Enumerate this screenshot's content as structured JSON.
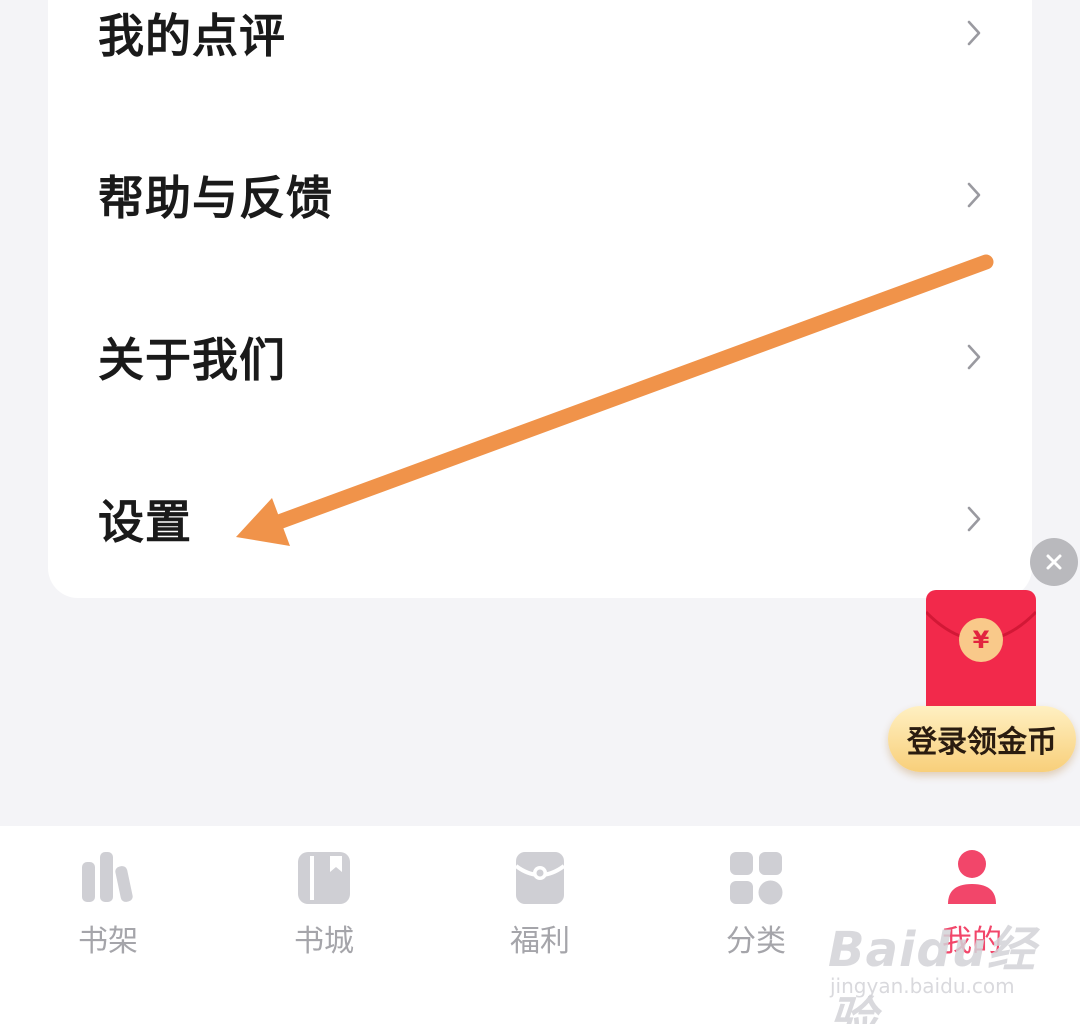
{
  "menu": {
    "items": [
      {
        "label": "我的点评"
      },
      {
        "label": "帮助与反馈"
      },
      {
        "label": "关于我们"
      },
      {
        "label": "设置"
      }
    ]
  },
  "promo": {
    "coin_symbol": "¥",
    "button_label": "登录领金币"
  },
  "tabbar": {
    "tabs": [
      {
        "label": "书架",
        "icon": "bookshelf-icon",
        "active": false
      },
      {
        "label": "书城",
        "icon": "book-icon",
        "active": false
      },
      {
        "label": "福利",
        "icon": "gift-icon",
        "active": false
      },
      {
        "label": "分类",
        "icon": "category-icon",
        "active": false
      },
      {
        "label": "我的",
        "icon": "profile-icon",
        "active": true
      }
    ]
  },
  "watermark": {
    "main": "Baidu经验",
    "sub": "jingyan.baidu.com"
  },
  "colors": {
    "accent": "#f2466a",
    "annotation_arrow": "#f0934a",
    "redpacket": "#f2294b"
  }
}
